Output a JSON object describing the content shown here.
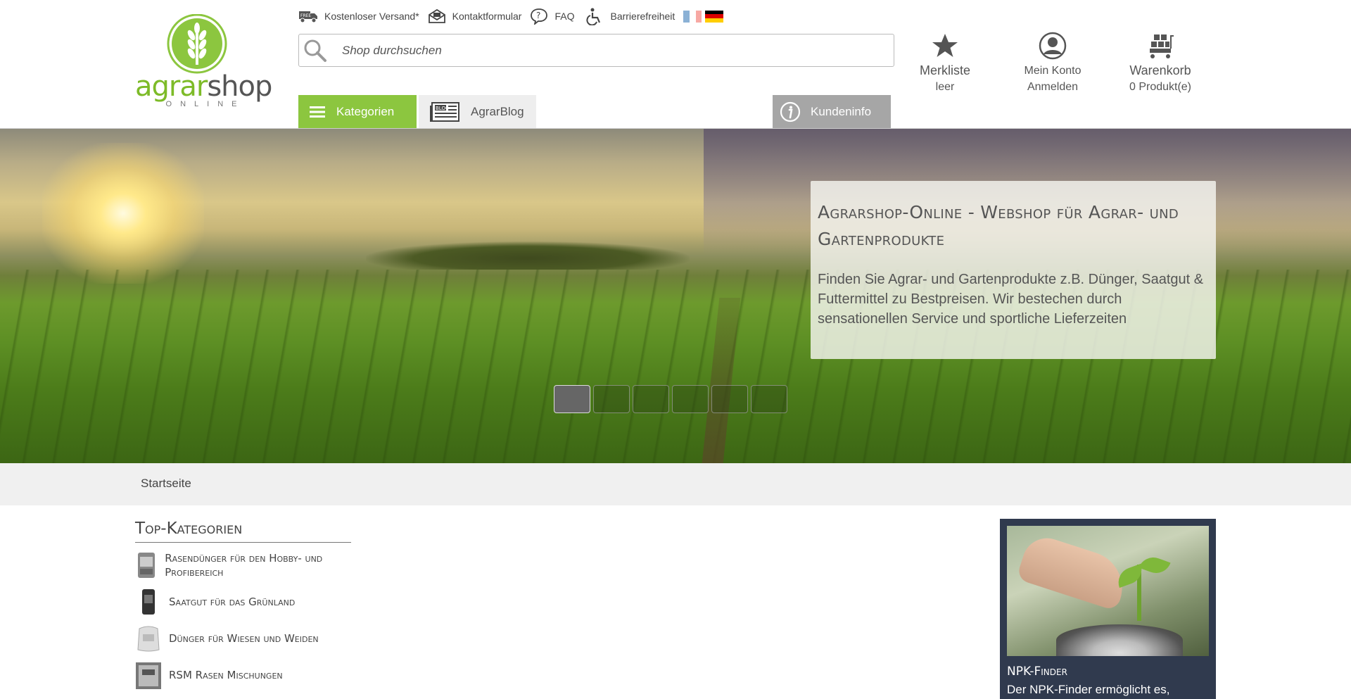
{
  "logo": {
    "part1": "agrar",
    "part2": "shop",
    "sub": "ONLINE"
  },
  "topbar": {
    "shipping": "Kostenloser Versand*",
    "contact": "Kontaktformular",
    "faq": "FAQ",
    "accessibility": "Barrierefreiheit"
  },
  "search": {
    "placeholder": "Shop durchsuchen"
  },
  "header_icons": {
    "wishlist": {
      "label": "Merkliste",
      "sub": "leer"
    },
    "account": {
      "label": "Mein Konto",
      "sub": "Anmelden"
    },
    "cart": {
      "label": "Warenkorb",
      "sub": "0 Produkt(e)"
    }
  },
  "nav": {
    "categories": "Kategorien",
    "blog": "AgrarBlog",
    "blog_icon_text": "BLOG",
    "info": "Kundeninfo"
  },
  "hero": {
    "title": "Agrarshop-Online - Webshop für Agrar- und Gartenprodukte",
    "text": "Finden Sie Agrar- und Gartenprodukte z.B. Dünger, Saatgut & Futtermittel zu Bestpreisen. Wir bestechen durch sensationellen Service und sportliche Lieferzeiten"
  },
  "breadcrumb": {
    "home": "Startseite"
  },
  "topcat": {
    "title": "Top-Kategorien",
    "items": [
      "Rasendünger für den Hobby- und Profibereich",
      "Saatgut für das Grünland",
      "Dünger für Wiesen und Weiden",
      "RSM Rasen Mischungen"
    ]
  },
  "npk": {
    "title": "NPK-Finder",
    "text": "Der NPK-Finder ermöglicht es,"
  },
  "colors": {
    "brand_green": "#8cc63f",
    "info_gray": "#a6a6a6",
    "npk_bg": "#303a4e"
  }
}
